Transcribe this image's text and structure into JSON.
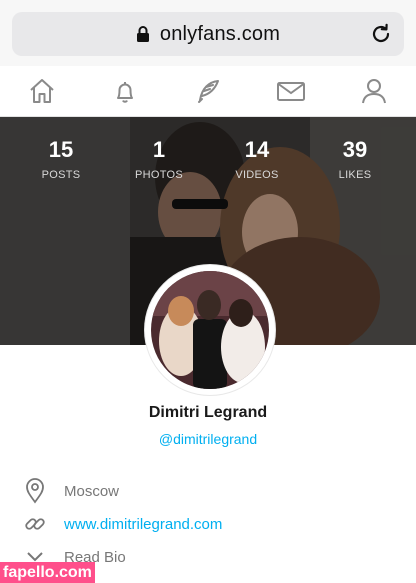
{
  "browser": {
    "url": "onlyfans.com"
  },
  "nav": {
    "items": [
      "home-icon",
      "bell-icon",
      "feather-icon",
      "envelope-icon",
      "profile-icon"
    ]
  },
  "stats": [
    {
      "count": "15",
      "label": "POSTS"
    },
    {
      "count": "1",
      "label": "PHOTOS"
    },
    {
      "count": "14",
      "label": "VIDEOS"
    },
    {
      "count": "39",
      "label": "LIKES"
    }
  ],
  "profile": {
    "name": "Dimitri Legrand",
    "handle": "@dimitrilegrand",
    "location": "Moscow",
    "website": "www.dimitrilegrand.com",
    "read_bio": "Read Bio"
  },
  "watermark": "fapello.com",
  "colors": {
    "accent": "#00aff0",
    "watermark_bg": "#ff4f8b"
  }
}
